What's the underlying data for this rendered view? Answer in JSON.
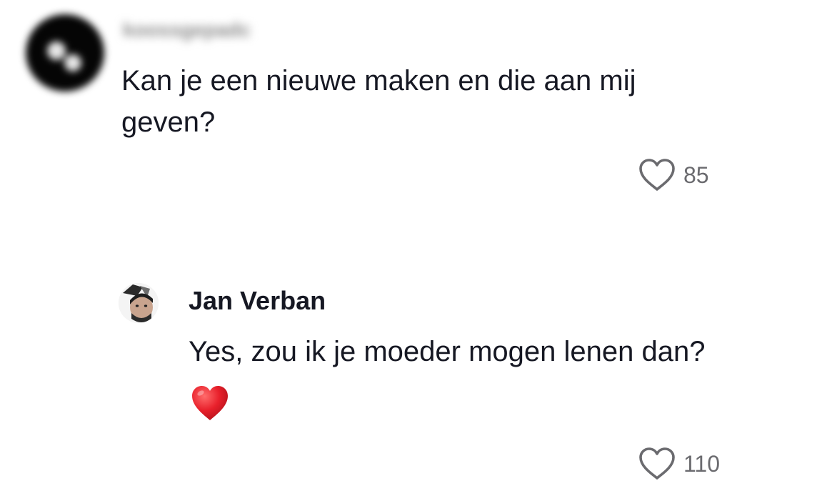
{
  "comments": [
    {
      "username": "koossgepadc",
      "avatar_icon": "blurred-avatar-icon",
      "text": "Kan je een nieuwe maken en die aan mij geven?",
      "like_icon": "heart-outline-icon",
      "likes": "85"
    }
  ],
  "reply": {
    "username": "Jan Verban",
    "avatar_icon": "profile-photo-avatar",
    "text": "Yes, zou ik je moeder mogen lenen dan?",
    "emoji": "red-heart-emoji",
    "like_icon": "heart-outline-icon",
    "likes": "110"
  },
  "colors": {
    "text": "#161823",
    "muted": "#6b6b6f",
    "heart": "#e8202b"
  }
}
